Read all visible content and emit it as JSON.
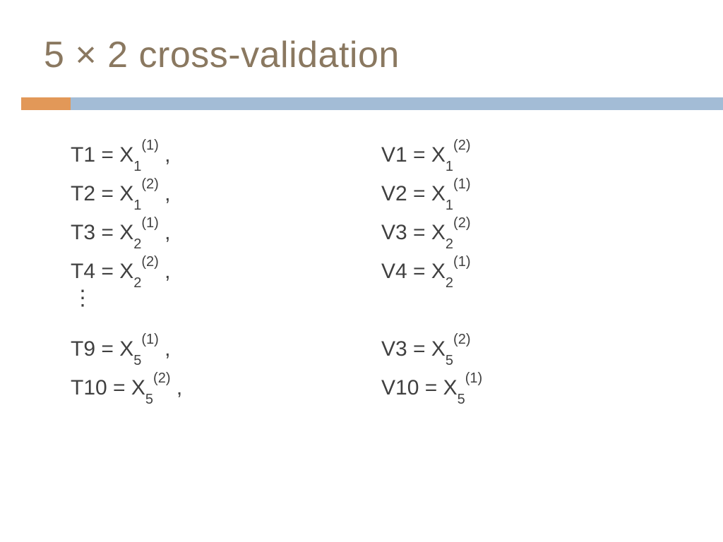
{
  "title": "5 × 2 cross-validation",
  "vdots": "⋮",
  "left": [
    {
      "lhs": "T1",
      "base": "X",
      "sub": "1",
      "sup": "(1)",
      "tail": "  ,"
    },
    {
      "lhs": "T2",
      "base": "X",
      "sub": "1",
      "sup": "(2)",
      "tail": " ,"
    },
    {
      "lhs": "T3",
      "base": "X",
      "sub": "2",
      "sup": "(1)",
      "tail": " ,"
    },
    {
      "lhs": "T4",
      "base": "X",
      "sub": "2",
      "sup": "(2)",
      "tail": " ,"
    },
    {
      "lhs": "T9",
      "base": "X",
      "sub": "5",
      "sup": "(1)",
      "tail": " ,"
    },
    {
      "lhs": "T10",
      "base": "X",
      "sub": "5",
      "sup": "(2)",
      "tail": " ,"
    }
  ],
  "right": [
    {
      "lhs": "V1",
      "base": "X",
      "sub": "1",
      "sup": "(2)",
      "tail": ""
    },
    {
      "lhs": "V2",
      "base": "X",
      "sub": "1",
      "sup": "(1)",
      "tail": ""
    },
    {
      "lhs": "V3",
      "base": "X",
      "sub": "2",
      "sup": "(2)",
      "tail": ""
    },
    {
      "lhs": "V4",
      "base": "X",
      "sub": "2",
      "sup": "(1)",
      "tail": ""
    },
    {
      "lhs": "V3",
      "base": "X",
      "sub": "5",
      "sup": "(2)",
      "tail": ""
    },
    {
      "lhs": "V10",
      "base": "X",
      "sub": "5",
      "sup": "(1)",
      "tail": ""
    }
  ]
}
